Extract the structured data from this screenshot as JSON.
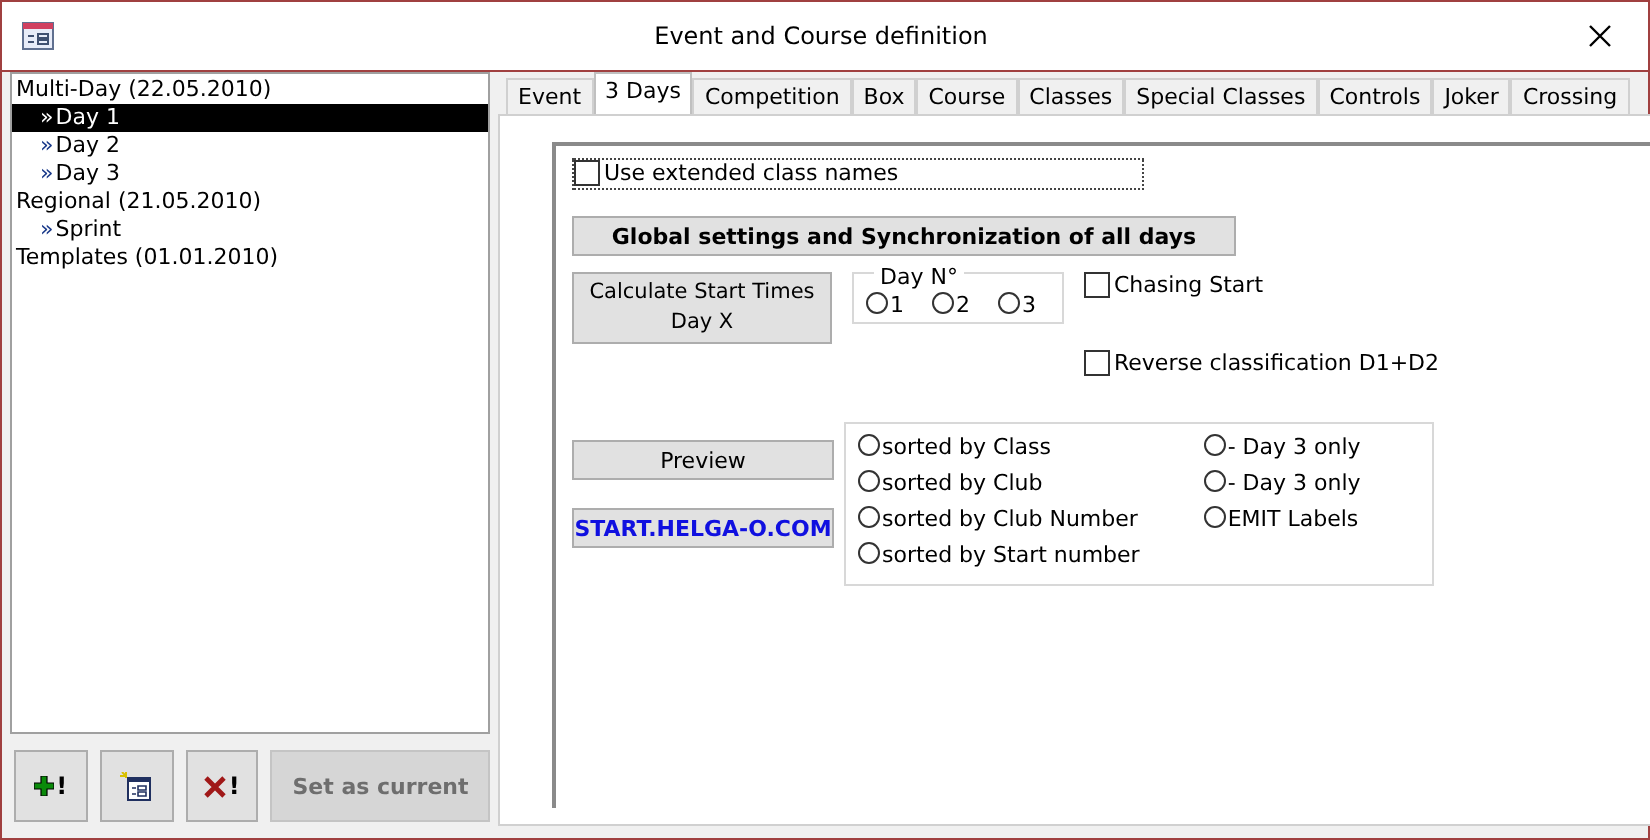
{
  "window": {
    "title": "Event and Course definition"
  },
  "tree": [
    {
      "label": "Multi-Day (22.05.2010)",
      "selected": false,
      "children": [
        {
          "label": "Day 1",
          "selected": true
        },
        {
          "label": "Day 2",
          "selected": false
        },
        {
          "label": "Day 3",
          "selected": false
        }
      ]
    },
    {
      "label": "Regional (21.05.2010)",
      "selected": false,
      "children": [
        {
          "label": "Sprint",
          "selected": false
        }
      ]
    },
    {
      "label": "Templates (01.01.2010)",
      "selected": false
    }
  ],
  "bullet": "»",
  "bottom_buttons": [
    {
      "kind": "add",
      "label": "!",
      "disabled": false
    },
    {
      "kind": "form",
      "disabled": false
    },
    {
      "kind": "delete",
      "label": "!",
      "disabled": false
    },
    {
      "kind": "text",
      "label": "Set as current",
      "disabled": true
    }
  ],
  "tabs": [
    {
      "label": "Event",
      "selected": false
    },
    {
      "label": "3 Days",
      "selected": true
    },
    {
      "label": "Competition",
      "selected": false
    },
    {
      "label": "Box",
      "selected": false
    },
    {
      "label": "Course",
      "selected": false
    },
    {
      "label": "Classes",
      "selected": false
    },
    {
      "label": "Special Classes",
      "selected": false
    },
    {
      "label": "Controls",
      "selected": false
    },
    {
      "label": "Joker",
      "selected": false
    },
    {
      "label": "Crossing",
      "selected": false
    }
  ],
  "extended_names": {
    "label": "Use extended class names",
    "checked": false
  },
  "global_button": "Global settings and Synchronization of all days",
  "calc_button": "Calculate Start Times Day X",
  "day_group": {
    "title": "Day N°",
    "options": [
      {
        "label": "1",
        "selected": false
      },
      {
        "label": "2",
        "selected": false
      },
      {
        "label": "3",
        "selected": false
      }
    ]
  },
  "chasing_start": {
    "label": "Chasing Start",
    "checked": false
  },
  "reverse": {
    "label": "Reverse classification D1+D2",
    "checked": false
  },
  "preview_button": "Preview",
  "link_button": "START.HELGA-O.COM",
  "sort_left": [
    {
      "label": "sorted by Class",
      "selected": false
    },
    {
      "label": "sorted by Club",
      "selected": false
    },
    {
      "label": "sorted by Club Number",
      "selected": false
    },
    {
      "label": "sorted by Start number",
      "selected": false
    }
  ],
  "sort_right": [
    {
      "label": "- Day 3 only",
      "selected": false
    },
    {
      "label": "- Day 3 only",
      "selected": false
    },
    {
      "label": "EMIT Labels",
      "selected": false
    }
  ]
}
